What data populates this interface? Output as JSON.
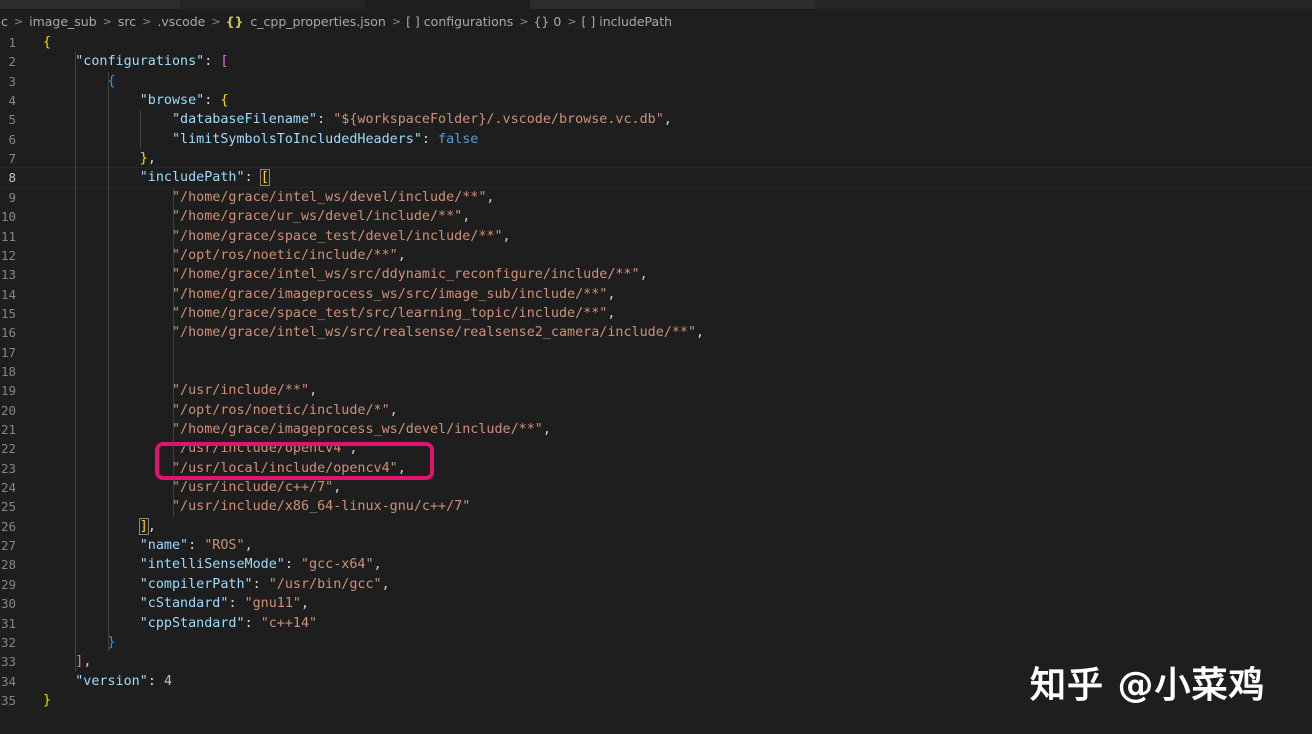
{
  "breadcrumb": {
    "items": [
      {
        "text": "c",
        "icon": ""
      },
      {
        "text": "image_sub",
        "icon": ""
      },
      {
        "text": "src",
        "icon": ""
      },
      {
        "text": ".vscode",
        "icon": ""
      },
      {
        "text": "c_cpp_properties.json",
        "icon": "{}"
      },
      {
        "text": "configurations",
        "icon": "[ ]"
      },
      {
        "text": "0",
        "icon": "{}"
      },
      {
        "text": "includePath",
        "icon": "[ ]"
      }
    ],
    "separator": ">"
  },
  "editor": {
    "file": "c_cpp_properties.json",
    "current_line": 8,
    "lines": [
      {
        "n": "1",
        "tokens": [
          [
            "b1",
            "{"
          ]
        ]
      },
      {
        "n": "2",
        "tokens": [
          [
            "p",
            "    "
          ],
          [
            "k",
            "\"configurations\""
          ],
          [
            "p",
            ": "
          ],
          [
            "b2",
            "["
          ]
        ]
      },
      {
        "n": "3",
        "tokens": [
          [
            "p",
            "        "
          ],
          [
            "b3",
            "{"
          ]
        ]
      },
      {
        "n": "4",
        "tokens": [
          [
            "p",
            "            "
          ],
          [
            "k",
            "\"browse\""
          ],
          [
            "p",
            ": "
          ],
          [
            "b1",
            "{"
          ]
        ]
      },
      {
        "n": "5",
        "tokens": [
          [
            "p",
            "                "
          ],
          [
            "k",
            "\"databaseFilename\""
          ],
          [
            "p",
            ": "
          ],
          [
            "s",
            "\"${workspaceFolder}/.vscode/browse.vc.db\""
          ],
          [
            "p",
            ","
          ]
        ]
      },
      {
        "n": "6",
        "tokens": [
          [
            "p",
            "                "
          ],
          [
            "k",
            "\"limitSymbolsToIncludedHeaders\""
          ],
          [
            "p",
            ": "
          ],
          [
            "kw",
            "false"
          ]
        ]
      },
      {
        "n": "7",
        "tokens": [
          [
            "p",
            "            "
          ],
          [
            "b1",
            "}"
          ],
          [
            "p",
            ","
          ]
        ]
      },
      {
        "n": "8",
        "tokens": [
          [
            "p",
            "            "
          ],
          [
            "k",
            "\"includePath\""
          ],
          [
            "p",
            ": "
          ],
          [
            "b1hl",
            "["
          ]
        ]
      },
      {
        "n": "9",
        "tokens": [
          [
            "p",
            "                "
          ],
          [
            "s",
            "\"/home/grace/intel_ws/devel/include/**\""
          ],
          [
            "p",
            ","
          ]
        ]
      },
      {
        "n": "10",
        "tokens": [
          [
            "p",
            "                "
          ],
          [
            "s",
            "\"/home/grace/ur_ws/devel/include/**\""
          ],
          [
            "p",
            ","
          ]
        ]
      },
      {
        "n": "11",
        "tokens": [
          [
            "p",
            "                "
          ],
          [
            "s",
            "\"/home/grace/space_test/devel/include/**\""
          ],
          [
            "p",
            ","
          ]
        ]
      },
      {
        "n": "12",
        "tokens": [
          [
            "p",
            "                "
          ],
          [
            "s",
            "\"/opt/ros/noetic/include/**\""
          ],
          [
            "p",
            ","
          ]
        ]
      },
      {
        "n": "13",
        "tokens": [
          [
            "p",
            "                "
          ],
          [
            "s",
            "\"/home/grace/intel_ws/src/ddynamic_reconfigure/include/**\""
          ],
          [
            "p",
            ","
          ]
        ]
      },
      {
        "n": "14",
        "tokens": [
          [
            "p",
            "                "
          ],
          [
            "s",
            "\"/home/grace/imageprocess_ws/src/image_sub/include/**\""
          ],
          [
            "p",
            ","
          ]
        ]
      },
      {
        "n": "15",
        "tokens": [
          [
            "p",
            "                "
          ],
          [
            "s",
            "\"/home/grace/space_test/src/learning_topic/include/**\""
          ],
          [
            "p",
            ","
          ]
        ]
      },
      {
        "n": "16",
        "tokens": [
          [
            "p",
            "                "
          ],
          [
            "s",
            "\"/home/grace/intel_ws/src/realsense/realsense2_camera/include/**\""
          ],
          [
            "p",
            ","
          ]
        ]
      },
      {
        "n": "17",
        "tokens": []
      },
      {
        "n": "18",
        "tokens": []
      },
      {
        "n": "19",
        "tokens": [
          [
            "p",
            "                "
          ],
          [
            "s",
            "\"/usr/include/**\""
          ],
          [
            "p",
            ","
          ]
        ]
      },
      {
        "n": "20",
        "tokens": [
          [
            "p",
            "                "
          ],
          [
            "s",
            "\"/opt/ros/noetic/include/*\""
          ],
          [
            "p",
            ","
          ]
        ]
      },
      {
        "n": "21",
        "tokens": [
          [
            "p",
            "                "
          ],
          [
            "s",
            "\"/home/grace/imageprocess_ws/devel/include/**\""
          ],
          [
            "p",
            ","
          ]
        ]
      },
      {
        "n": "22",
        "tokens": [
          [
            "p",
            "                "
          ],
          [
            "s",
            "\"/usr/include/opencv4\""
          ],
          [
            "p",
            ","
          ]
        ]
      },
      {
        "n": "23",
        "tokens": [
          [
            "p",
            "                "
          ],
          [
            "s",
            "\"/usr/local/include/opencv4\""
          ],
          [
            "p",
            ","
          ]
        ]
      },
      {
        "n": "24",
        "tokens": [
          [
            "p",
            "                "
          ],
          [
            "s",
            "\"/usr/include/c++/7\""
          ],
          [
            "p",
            ","
          ]
        ]
      },
      {
        "n": "25",
        "tokens": [
          [
            "p",
            "                "
          ],
          [
            "s",
            "\"/usr/include/x86_64-linux-gnu/c++/7\""
          ]
        ]
      },
      {
        "n": "26",
        "tokens": [
          [
            "p",
            "            "
          ],
          [
            "b1hl",
            "]"
          ],
          [
            "p",
            ","
          ]
        ]
      },
      {
        "n": "27",
        "tokens": [
          [
            "p",
            "            "
          ],
          [
            "k",
            "\"name\""
          ],
          [
            "p",
            ": "
          ],
          [
            "s",
            "\"ROS\""
          ],
          [
            "p",
            ","
          ]
        ]
      },
      {
        "n": "28",
        "tokens": [
          [
            "p",
            "            "
          ],
          [
            "k",
            "\"intelliSenseMode\""
          ],
          [
            "p",
            ": "
          ],
          [
            "s",
            "\"gcc-x64\""
          ],
          [
            "p",
            ","
          ]
        ]
      },
      {
        "n": "29",
        "tokens": [
          [
            "p",
            "            "
          ],
          [
            "k",
            "\"compilerPath\""
          ],
          [
            "p",
            ": "
          ],
          [
            "s",
            "\"/usr/bin/gcc\""
          ],
          [
            "p",
            ","
          ]
        ]
      },
      {
        "n": "30",
        "tokens": [
          [
            "p",
            "            "
          ],
          [
            "k",
            "\"cStandard\""
          ],
          [
            "p",
            ": "
          ],
          [
            "s",
            "\"gnu11\""
          ],
          [
            "p",
            ","
          ]
        ]
      },
      {
        "n": "31",
        "tokens": [
          [
            "p",
            "            "
          ],
          [
            "k",
            "\"cppStandard\""
          ],
          [
            "p",
            ": "
          ],
          [
            "s",
            "\"c++14\""
          ]
        ]
      },
      {
        "n": "32",
        "tokens": [
          [
            "p",
            "        "
          ],
          [
            "b3",
            "}"
          ]
        ]
      },
      {
        "n": "33",
        "tokens": [
          [
            "p",
            "    "
          ],
          [
            "b2",
            "]"
          ],
          [
            "p",
            ","
          ]
        ]
      },
      {
        "n": "34",
        "tokens": [
          [
            "p",
            "    "
          ],
          [
            "k",
            "\"version\""
          ],
          [
            "p",
            ": "
          ],
          [
            "n",
            "4"
          ]
        ]
      },
      {
        "n": "35",
        "tokens": [
          [
            "b1",
            "}"
          ]
        ]
      }
    ]
  },
  "annotation": {
    "highlighted_line": "23",
    "color": "#e0136f"
  },
  "watermark": {
    "text": "知乎 @小菜鸡"
  },
  "colors": {
    "background": "#1e1e1e",
    "property_key": "#9cdcfe",
    "string": "#ce9178",
    "keyword": "#569cd6",
    "number": "#b5cea8",
    "bracket_gold": "#ffd700",
    "bracket_purple": "#da70d6",
    "bracket_blue": "#179fff"
  }
}
